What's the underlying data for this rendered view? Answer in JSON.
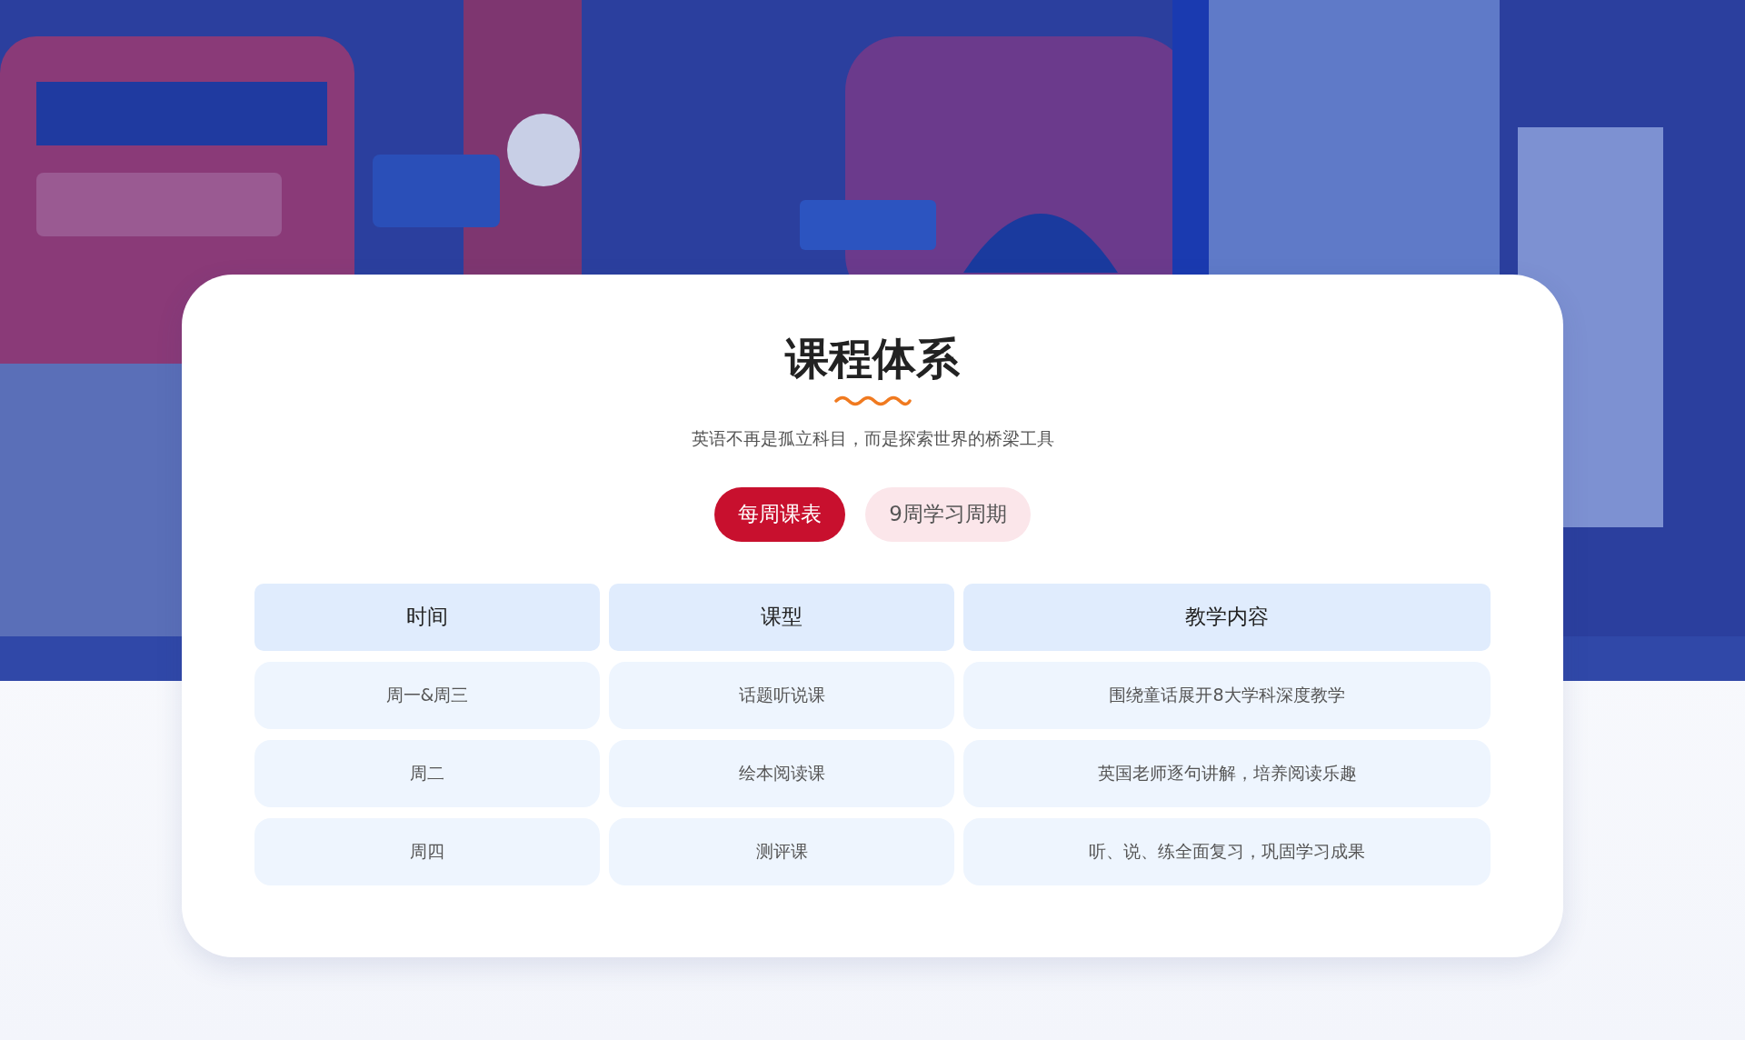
{
  "section": {
    "title": "课程体系",
    "subtitle": "英语不再是孤立科目，而是探索世界的桥梁工具"
  },
  "tabs": [
    {
      "label": "每周课表",
      "selected": true
    },
    {
      "label": "9周学习周期",
      "selected": false
    }
  ],
  "table": {
    "columns": [
      "时间",
      "课型",
      "教学内容"
    ],
    "rows": [
      [
        "周一&周三",
        "话题听说课",
        "围绕童话展开8大学科深度教学"
      ],
      [
        "周二",
        "绘本阅读课",
        "英国老师逐句讲解，培养阅读乐趣"
      ],
      [
        "周四",
        "测评课",
        "听、说、练全面复习，巩固学习成果"
      ]
    ]
  }
}
